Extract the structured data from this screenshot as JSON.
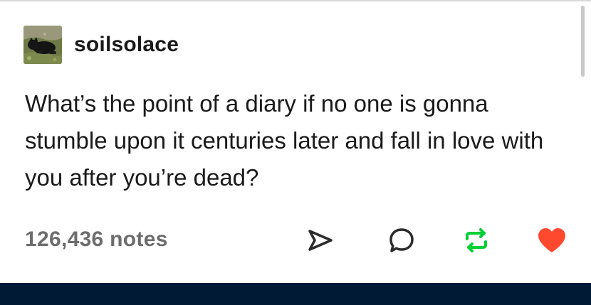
{
  "post": {
    "username": "soilsolace",
    "avatar": "black-dog-on-grass",
    "body": "What’s the point of a diary if no one is gonna stumble upon it centuries later and fall in love with you after you’re dead?",
    "notes_count": "126,436 notes"
  },
  "actions": {
    "share_icon": "paper-plane-icon",
    "reply_icon": "speech-bubble-icon",
    "reblog_icon": "reblog-arrows-icon",
    "like_icon": "heart-icon",
    "like_state": "liked"
  },
  "colors": {
    "text": "#1a1a1a",
    "notes": "#6d6d6d",
    "reblog": "#00cf35",
    "like": "#ff492f",
    "nav_bar": "#001935"
  }
}
